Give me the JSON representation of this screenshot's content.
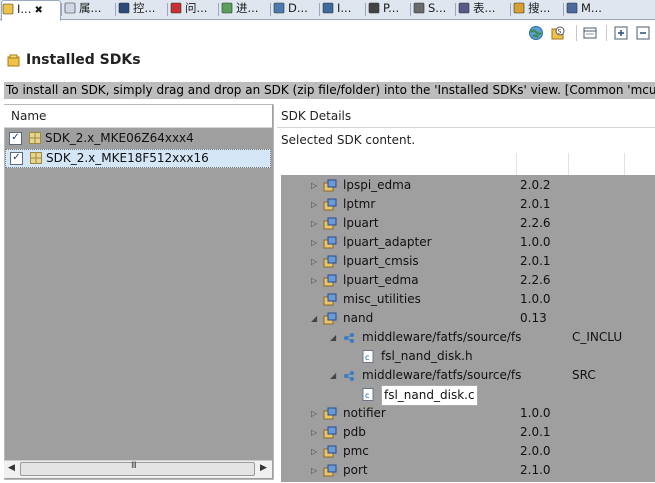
{
  "tabs": [
    {
      "label": "I...",
      "icon": "installed-sdks-icon",
      "active": true,
      "has_close": true
    },
    {
      "label": "属...",
      "icon": "properties-icon"
    },
    {
      "label": "控...",
      "icon": "console-icon"
    },
    {
      "label": "问...",
      "icon": "problems-icon"
    },
    {
      "label": "进...",
      "icon": "progress-icon"
    },
    {
      "label": "D...",
      "icon": "debug-icon"
    },
    {
      "label": "I...",
      "icon": "image-info-icon"
    },
    {
      "label": "P...",
      "icon": "power-icon"
    },
    {
      "label": "S...",
      "icon": "swo-icon"
    },
    {
      "label": "表...",
      "icon": "expressions-icon"
    },
    {
      "label": "搜...",
      "icon": "search-icon"
    },
    {
      "label": "M...",
      "icon": "memory-icon"
    }
  ],
  "toolbar": [
    "globe-icon",
    "import-sdk-icon",
    "view-menu-icon",
    "expand-icon",
    "collapse-icon"
  ],
  "view_title": "Installed SDKs",
  "info_text": "To install an SDK, simply drag and drop an SDK (zip file/folder) into the 'Installed SDKs' view. [Common 'mcuxpresso'",
  "left": {
    "column_header": "Name",
    "sdks": [
      {
        "name": "SDK_2.x_MKE06Z64xxx4",
        "checked": true,
        "selected": false
      },
      {
        "name": "SDK_2.x_MKE18F512xxx16",
        "checked": true,
        "selected": true
      }
    ],
    "scroll_thumb_grip": "III"
  },
  "right": {
    "header": "SDK Details",
    "subtitle": "Selected SDK content.",
    "rows": [
      {
        "indent": 0,
        "twisty": "right",
        "icon": "component-icon",
        "name": "lpspi_edma",
        "version": "2.0.2",
        "col3": ""
      },
      {
        "indent": 0,
        "twisty": "right",
        "icon": "component-icon",
        "name": "lptmr",
        "version": "2.0.1",
        "col3": ""
      },
      {
        "indent": 0,
        "twisty": "right",
        "icon": "component-icon",
        "name": "lpuart",
        "version": "2.2.6",
        "col3": ""
      },
      {
        "indent": 0,
        "twisty": "right",
        "icon": "component-icon",
        "name": "lpuart_adapter",
        "version": "1.0.0",
        "col3": ""
      },
      {
        "indent": 0,
        "twisty": "right",
        "icon": "component-icon",
        "name": "lpuart_cmsis",
        "version": "2.0.1",
        "col3": ""
      },
      {
        "indent": 0,
        "twisty": "right",
        "icon": "component-icon",
        "name": "lpuart_edma",
        "version": "2.2.6",
        "col3": ""
      },
      {
        "indent": 0,
        "twisty": "none",
        "icon": "component-icon",
        "name": "misc_utilities",
        "version": "1.0.0",
        "col3": ""
      },
      {
        "indent": 0,
        "twisty": "down",
        "icon": "component-icon",
        "name": "nand",
        "version": "0.13",
        "col3": ""
      },
      {
        "indent": 1,
        "twisty": "down",
        "icon": "folder-link-icon",
        "name": "middleware/fatfs/source/fs",
        "version": "",
        "col3": "C_INCLU"
      },
      {
        "indent": 2,
        "twisty": "none",
        "icon": "c-file-icon",
        "name": "fsl_nand_disk.h",
        "version": "",
        "col3": ""
      },
      {
        "indent": 1,
        "twisty": "down",
        "icon": "folder-link-icon",
        "name": "middleware/fatfs/source/fs",
        "version": "",
        "col3": "SRC"
      },
      {
        "indent": 2,
        "twisty": "none",
        "icon": "c-file-icon",
        "name": "fsl_nand_disk.c",
        "version": "",
        "col3": "",
        "selected": true
      },
      {
        "indent": 0,
        "twisty": "right",
        "icon": "component-icon",
        "name": "notifier",
        "version": "1.0.0",
        "col3": ""
      },
      {
        "indent": 0,
        "twisty": "right",
        "icon": "component-icon",
        "name": "pdb",
        "version": "2.0.1",
        "col3": ""
      },
      {
        "indent": 0,
        "twisty": "right",
        "icon": "component-icon",
        "name": "pmc",
        "version": "2.0.0",
        "col3": ""
      },
      {
        "indent": 0,
        "twisty": "right",
        "icon": "component-icon",
        "name": "port",
        "version": "2.1.0",
        "col3": ""
      }
    ]
  },
  "colors": {
    "panel_bg": "#9f9f9f",
    "info_bg": "#bdbdbd",
    "selection": "#d5e6f7",
    "tab_bar": "#dfe6ef"
  }
}
